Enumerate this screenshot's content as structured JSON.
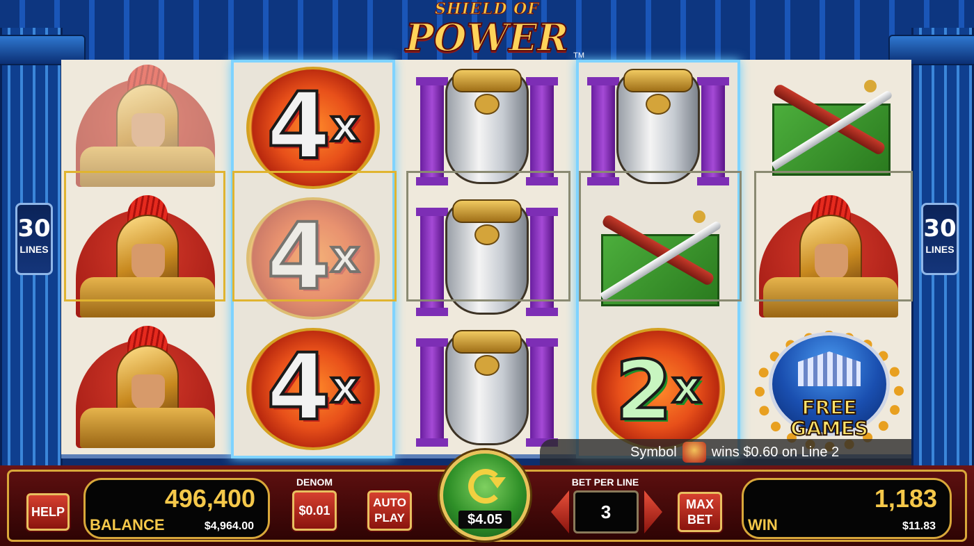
{
  "logo": {
    "line1": "SHIELD OF",
    "line2": "POWER",
    "tm": "TM"
  },
  "lines_badge": {
    "left_num": "30",
    "left_label": "LINES",
    "right_num": "30",
    "right_label": "LINES"
  },
  "reels": {
    "reel2": {
      "top": "4",
      "middle": "4",
      "bottom": "4",
      "suffix": "x"
    },
    "reel4_bottom": {
      "value": "2",
      "suffix": "x"
    },
    "free_games": {
      "line1": "FREE",
      "line2": "GAMES"
    }
  },
  "win_message": {
    "prefix": "Symbol",
    "suffix": "wins $0.60 on Line 2"
  },
  "controls": {
    "help": "HELP",
    "balance_credits": "496,400",
    "balance_label": "BALANCE",
    "balance_dollars": "$4,964.00",
    "denom_label": "DENOM",
    "denom_value": "$0.01",
    "auto_play_1": "AUTO",
    "auto_play_2": "PLAY",
    "spin_amount": "$4.05",
    "bet_per_line_label": "BET PER LINE",
    "bet_per_line_value": "3",
    "max_bet_1": "MAX",
    "max_bet_2": "BET",
    "win_credits": "1,183",
    "win_label": "WIN",
    "win_dollars": "$11.83"
  },
  "colors": {
    "accent_gold": "#d9a83a",
    "bar_red": "#5c0f0f",
    "reel_glow": "#7fd3ff"
  }
}
